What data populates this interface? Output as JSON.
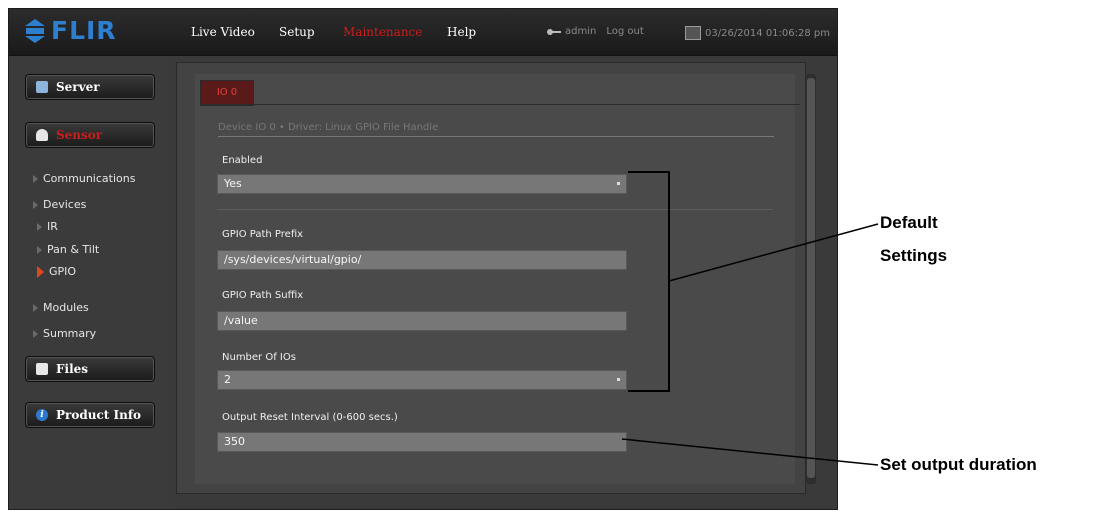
{
  "logo": "FLIR",
  "nav": {
    "live_video": "Live Video",
    "setup": "Setup",
    "maintenance": "Maintenance",
    "help": "Help"
  },
  "user": {
    "name": "admin",
    "logout": "Log out"
  },
  "datetime": "03/26/2014 01:06:28 pm",
  "sidebar": {
    "server": "Server",
    "sensor": "Sensor",
    "communications": "Communications",
    "devices": "Devices",
    "ir": "IR",
    "pan_tilt": "Pan & Tilt",
    "gpio": "GPIO",
    "modules": "Modules",
    "summary": "Summary",
    "files": "Files",
    "product_info": "Product Info"
  },
  "tab": "IO 0",
  "device_info": "Device IO 0  •  Driver: Linux GPIO File Handle",
  "form": {
    "enabled_label": "Enabled",
    "enabled_value": "Yes",
    "prefix_label": "GPIO Path Prefix",
    "prefix_value": "/sys/devices/virtual/gpio/",
    "suffix_label": "GPIO Path Suffix",
    "suffix_value": "/value",
    "num_ios_label": "Number Of IOs",
    "num_ios_value": "2",
    "reset_label": "Output Reset Interval (0-600 secs.)",
    "reset_value": "350"
  },
  "callouts": {
    "default_line1": "Default",
    "default_line2": "Settings",
    "output": "Set output duration"
  },
  "colors": {
    "accent_red": "#c81e1e",
    "brand_blue": "#2d7fd0"
  }
}
